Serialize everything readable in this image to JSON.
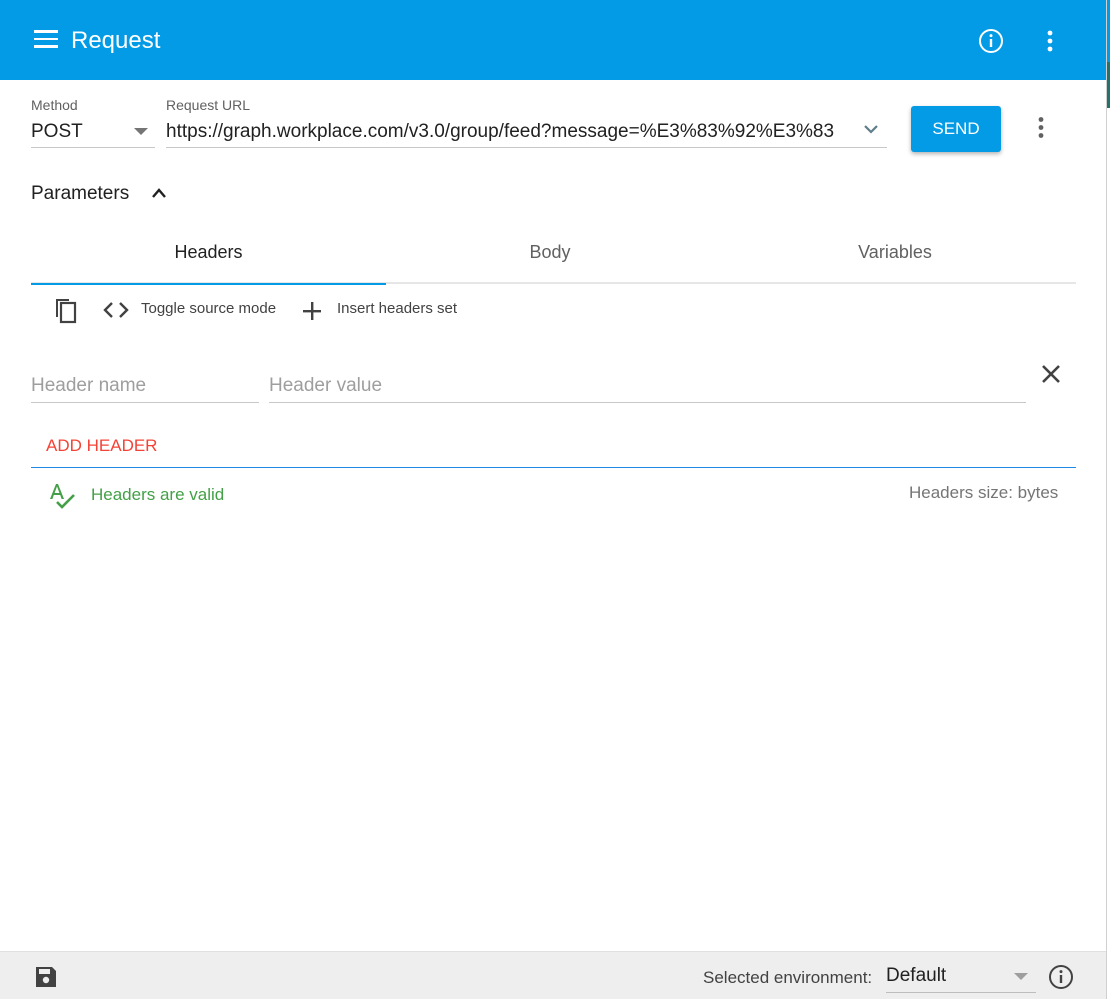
{
  "appbar": {
    "title": "Request",
    "menu_icon": "menu-icon",
    "info_icon": "info-icon",
    "more_icon": "more-vert-icon"
  },
  "request": {
    "method_label": "Method",
    "method_value": "POST",
    "url_label": "Request URL",
    "url_value": "https://graph.workplace.com/v3.0/group/feed?message=%E3%83%92%E3%83",
    "send_label": "SEND"
  },
  "parameters": {
    "title": "Parameters",
    "tabs": [
      {
        "label": "Headers",
        "active": true
      },
      {
        "label": "Body",
        "active": false
      },
      {
        "label": "Variables",
        "active": false
      }
    ]
  },
  "toolbar": {
    "copy_icon": "copy-icon",
    "toggle_label": "Toggle source mode",
    "insert_label": "Insert headers set"
  },
  "headers": {
    "name_placeholder": "Header name",
    "value_placeholder": "Header value",
    "add_label": "ADD HEADER",
    "valid_text": "Headers are valid",
    "size_text": "Headers size: bytes"
  },
  "statusbar": {
    "env_label": "Selected environment:",
    "env_value": "Default"
  },
  "colors": {
    "primary": "#039be5",
    "accent_red": "#f44336",
    "valid_green": "#43a047"
  }
}
